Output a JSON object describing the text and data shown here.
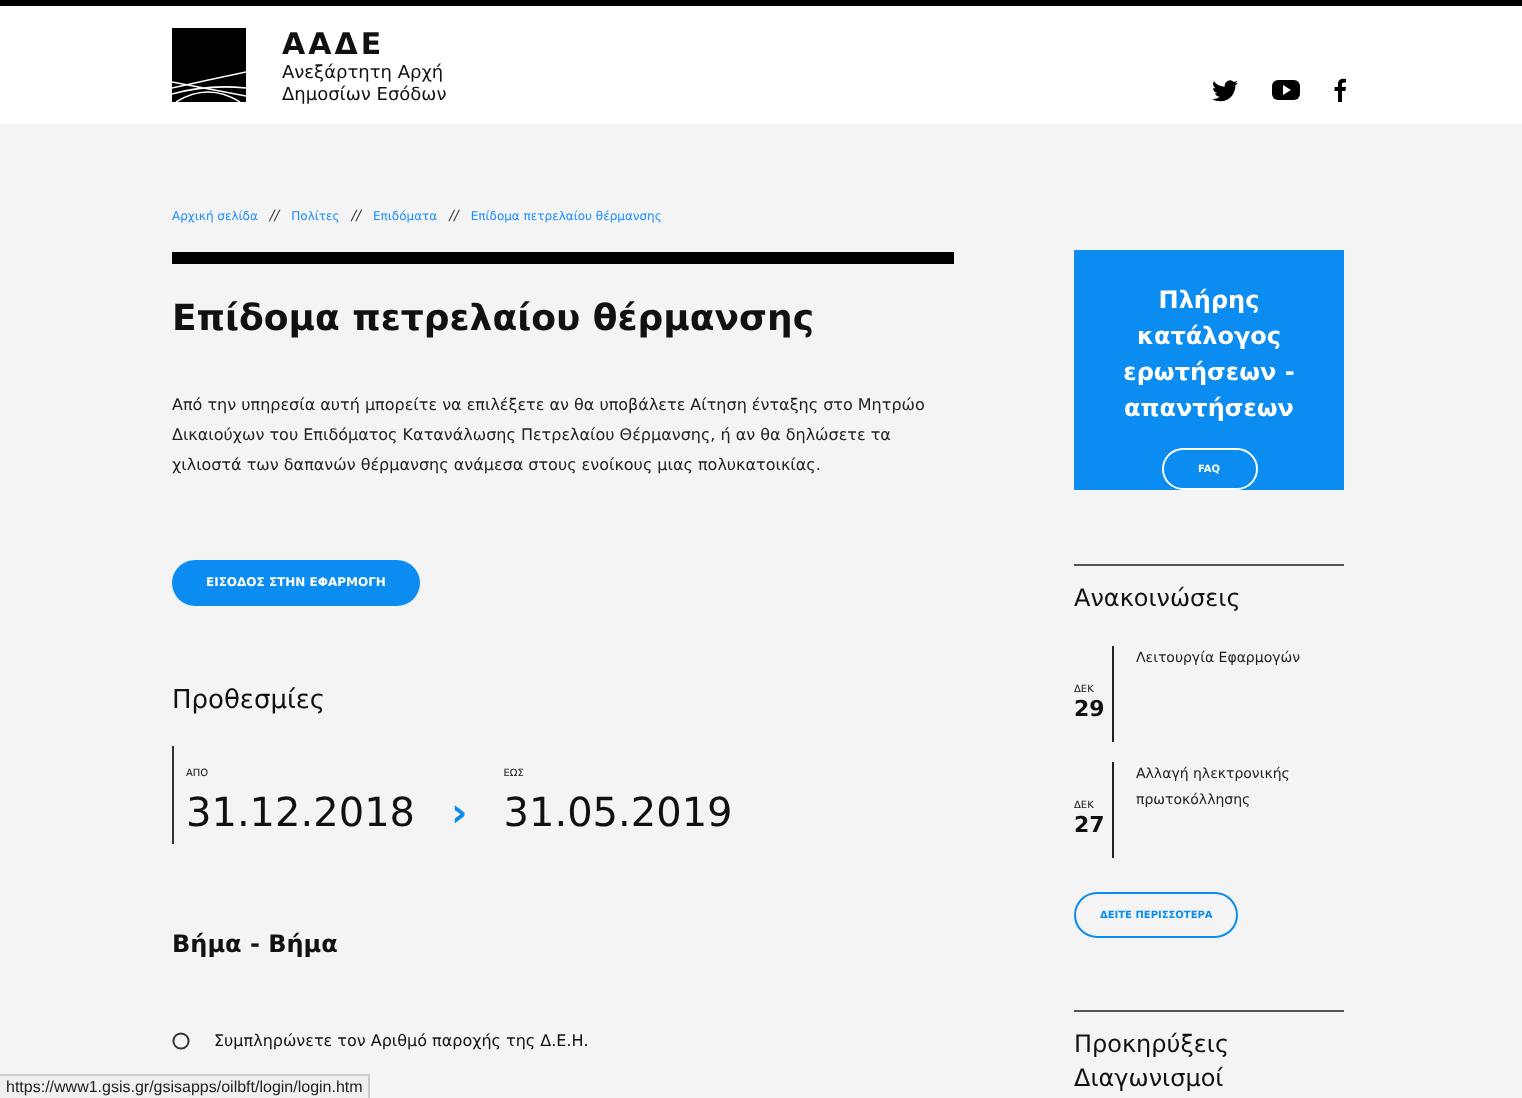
{
  "header": {
    "logo_title": "ΑΑΔΕ",
    "logo_subtitle": [
      "Ανεξάρτητη Αρχή",
      "Δημοσίων Εσόδων"
    ]
  },
  "breadcrumb": [
    "Αρχική σελίδα",
    "Πολίτες",
    "Επιδόματα",
    "Επίδομα πετρελαίου θέρμανσης"
  ],
  "breadcrumb_separator": "//",
  "title": "Επίδομα πετρελαίου θέρμανσης",
  "description": "Από την υπηρεσία αυτή μπορείτε να επιλέξετε αν θα υποβάλετε Αίτηση ένταξης στο Μητρώο Δικαιούχων του Επιδόματος Κατανάλωσης Πετρελαίου Θέρμανσης, ή αν θα δηλώσετε τα χιλιοστά των δαπανών θέρμανσης ανάμεσα στους ενοίκους μιας πολυκατοικίας.",
  "enter_button": "ΕΙΣΟΔΟΣ ΣΤΗΝ ΕΦΑΡΜΟΓΗ",
  "deadlines": {
    "heading": "Προθεσμίες",
    "from_label": "ΑΠΟ",
    "from": "31.12.2018",
    "arrow": "›",
    "to_label": "ΕΩΣ",
    "to": "31.05.2019"
  },
  "steps": {
    "heading": "Βήμα - Βήμα",
    "items": [
      "Συμπληρώνετε τον Αριθμό παροχής της Δ.Ε.Η."
    ]
  },
  "faq_box": {
    "title": "Πλήρης κατάλογος ερωτήσεων - απαντήσεων",
    "button": "FAQ"
  },
  "announcements": {
    "heading": "Ανακοινώσεις",
    "items": [
      {
        "month": "ΔΕΚ",
        "day": "29",
        "text": "Λειτουργία Εφαρμογών"
      },
      {
        "month": "ΔΕΚ",
        "day": "27",
        "text": "Αλλαγή ηλεκτρονικής πρωτοκόλλησης"
      }
    ],
    "more_button": "ΔΕΙΤΕ ΠΕΡΙΣΣΟΤΕΡΑ"
  },
  "tenders_heading": "Προκηρύξεις Διαγωνισμοί",
  "status_bar": "https://www1.gsis.gr/gsisapps/oilbft/login/login.htm"
}
